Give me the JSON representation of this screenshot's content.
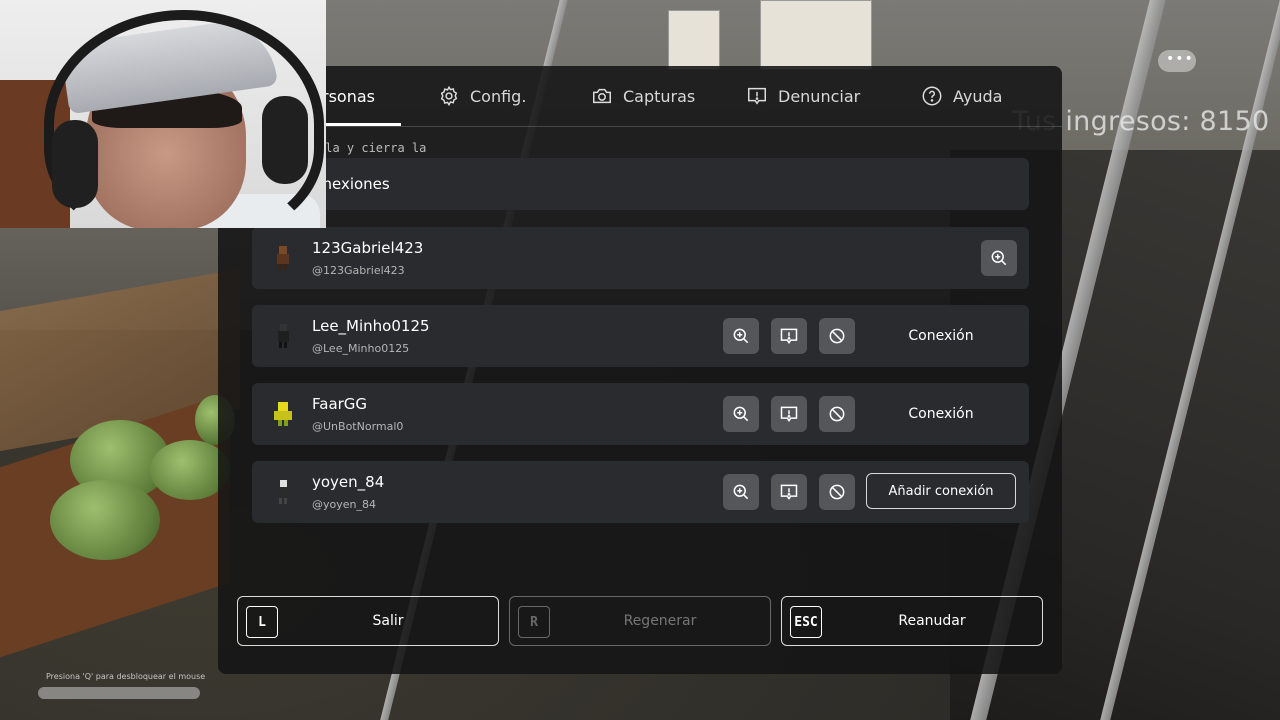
{
  "tabs": [
    {
      "label": "rsonas",
      "icon": "people-icon"
    },
    {
      "label": "Config.",
      "icon": "gear-icon"
    },
    {
      "label": "Capturas",
      "icon": "camera-icon"
    },
    {
      "label": "Denunciar",
      "icon": "report-icon"
    },
    {
      "label": "Ayuda",
      "icon": "help-icon"
    }
  ],
  "background": {
    "earnings": "Tus ingresos: 8150",
    "unlock_hint": "Presiona 'Q' para desbloquear el mouse",
    "faint_text": "lla y cierra la"
  },
  "invite_label": "vitar conexiones",
  "players": [
    {
      "name": "123Gabriel423",
      "handle": "@123Gabriel423",
      "action": ""
    },
    {
      "name": "Lee_Minho0125",
      "handle": "@Lee_Minho0125",
      "action": "Conexión"
    },
    {
      "name": "FaarGG",
      "handle": "@UnBotNormal0",
      "action": "Conexión"
    },
    {
      "name": "yoyen_84",
      "handle": "@yoyen_84",
      "action": "Añadir conexión"
    }
  ],
  "footer": {
    "leave": {
      "key": "L",
      "label": "Salir"
    },
    "respawn": {
      "key": "R",
      "label": "Regenerar"
    },
    "resume": {
      "key": "ESC",
      "label": "Reanudar"
    }
  },
  "colors": {
    "panel": "#141416",
    "row": "#2a2b2e",
    "icon_button": "#55565a"
  }
}
